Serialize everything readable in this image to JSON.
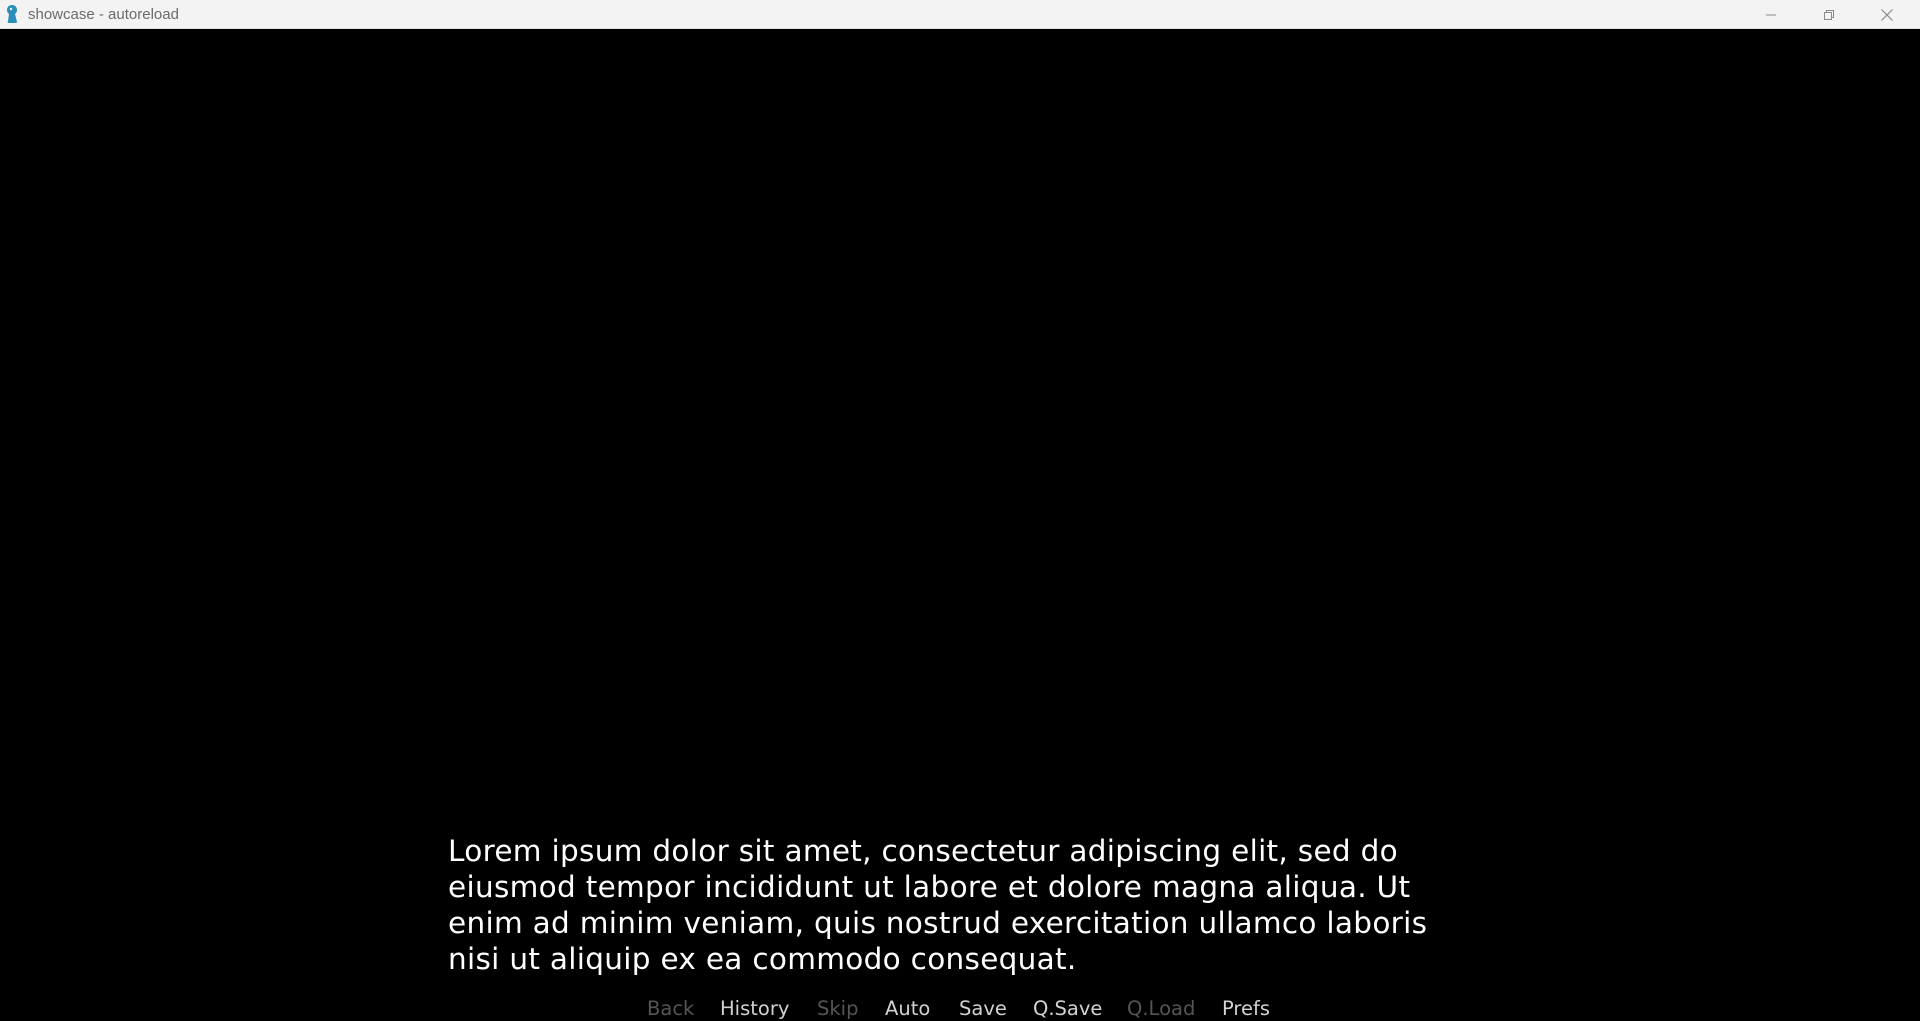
{
  "window": {
    "title": "showcase - autoreload",
    "icon": "renpy-icon",
    "controls": {
      "minimize": "minimize-icon",
      "maximize": "restore-icon",
      "close": "close-icon"
    }
  },
  "dialogue": {
    "text": "Lorem ipsum dolor sit amet, consectetur adipiscing elit, sed do eiusmod tempor incididunt ut labore et dolore magna aliqua. Ut enim ad minim veniam, quis nostrud exercitation ullamco laboris nisi ut aliquip ex ea commodo consequat."
  },
  "quick_menu": {
    "items": [
      {
        "label": "Back",
        "enabled": false
      },
      {
        "label": "History",
        "enabled": true
      },
      {
        "label": "Skip",
        "enabled": false
      },
      {
        "label": "Auto",
        "enabled": true
      },
      {
        "label": "Save",
        "enabled": true
      },
      {
        "label": "Q.Save",
        "enabled": true
      },
      {
        "label": "Q.Load",
        "enabled": false
      },
      {
        "label": "Prefs",
        "enabled": true
      }
    ]
  },
  "colors": {
    "background": "#000000",
    "text": "#ffffff",
    "menu_enabled": "#d2d2d2",
    "menu_disabled": "#555555",
    "titlebar": "#f3f3f3"
  }
}
